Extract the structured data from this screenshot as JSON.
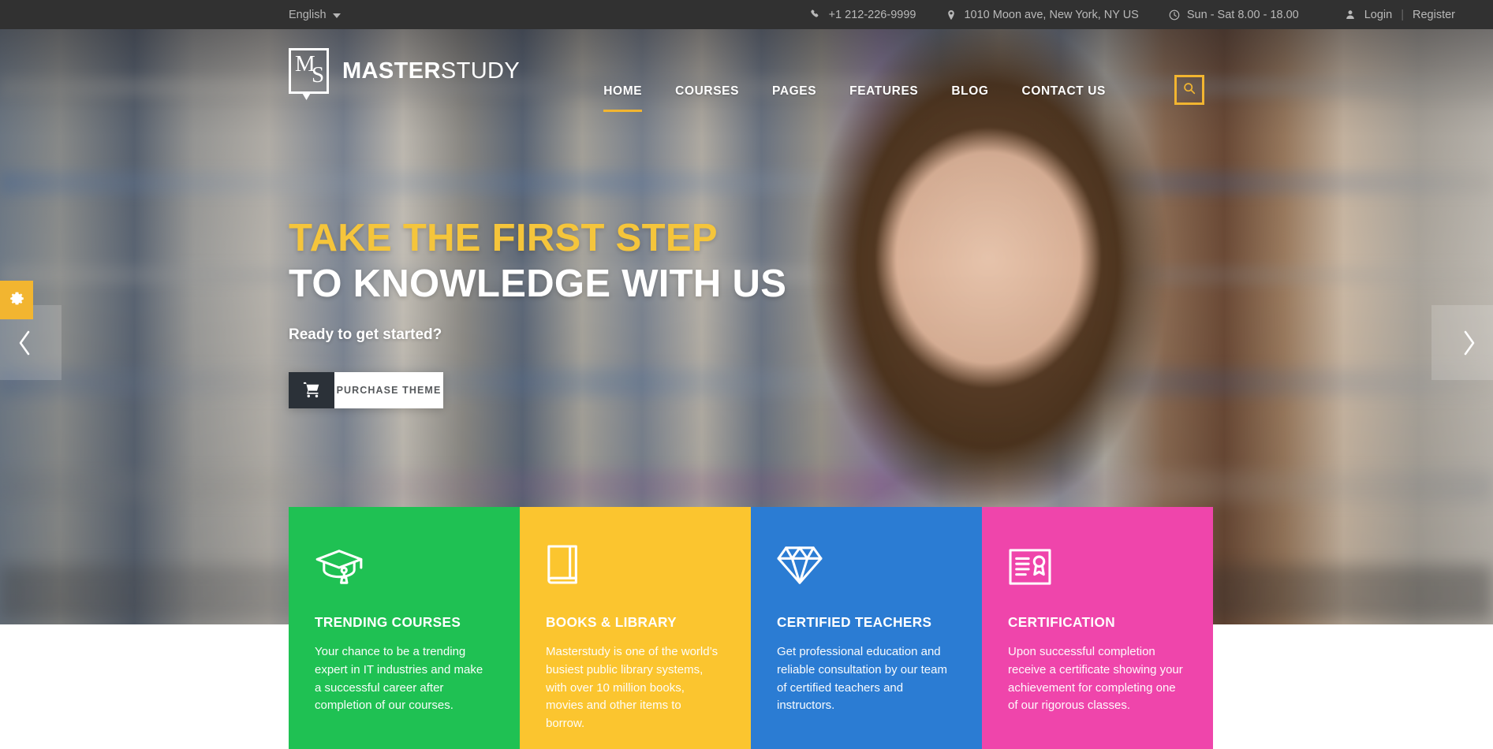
{
  "topbar": {
    "language": "English",
    "language_icon": "chevron-down-icon",
    "phone": "+1 212-226-9999",
    "phone_icon": "phone-icon",
    "address": "1010 Moon ave, New York, NY US",
    "address_icon": "map-pin-icon",
    "hours": "Sun - Sat 8.00 - 18.00",
    "hours_icon": "clock-icon",
    "user_icon": "user-icon",
    "login": "Login",
    "separator": "|",
    "register": "Register",
    "bg_color": "#313131",
    "text_color": "#b9b9b9"
  },
  "header": {
    "logo_mark_letter_1": "M",
    "logo_mark_letter_2": "S",
    "logo_text_bold": "MASTER",
    "logo_text_light": "STUDY",
    "nav": [
      {
        "label": "HOME",
        "active": true
      },
      {
        "label": "COURSES",
        "active": false
      },
      {
        "label": "PAGES",
        "active": false
      },
      {
        "label": "FEATURES",
        "active": false
      },
      {
        "label": "BLOG",
        "active": false
      },
      {
        "label": "CONTACT US",
        "active": false
      }
    ],
    "search_icon": "search-icon",
    "accent_color": "#f2b530"
  },
  "hero": {
    "title_line_1": "TAKE THE FIRST STEP",
    "title_line_2": "TO KNOWLEDGE WITH US",
    "title_line_1_color": "#f5c53b",
    "title_line_2_color": "#ffffff",
    "subtitle": "Ready to get started?",
    "cta_label": "PURCHASE THEME",
    "cta_icon": "shopping-cart-icon",
    "prev_icon": "chevron-left-icon",
    "next_icon": "chevron-right-icon",
    "settings_icon": "gear-icon"
  },
  "cards": [
    {
      "icon": "graduation-cap-icon",
      "title": "TRENDING COURSES",
      "text": "Your chance to be a trending expert in IT industries and make a successful career after completion of our courses.",
      "color": "#1fc153"
    },
    {
      "icon": "book-icon",
      "title": "BOOKS & LIBRARY",
      "text": "Masterstudy is one of the world’s busiest public library systems, with over 10 million books, movies and other items to borrow.",
      "color": "#fbc52f"
    },
    {
      "icon": "diamond-icon",
      "title": "CERTIFIED TEACHERS",
      "text": "Get professional education and reliable consultation by our team of certified teachers and instructors.",
      "color": "#2b7cd3"
    },
    {
      "icon": "certificate-icon",
      "title": "CERTIFICATION",
      "text": "Upon successful completion receive a certificate showing your achievement for completing one of our rigorous classes.",
      "color": "#ef45ab"
    }
  ]
}
